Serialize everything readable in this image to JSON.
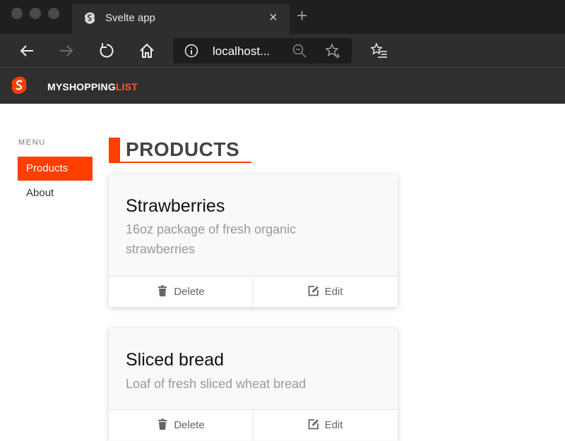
{
  "browser": {
    "tab_title": "Svelte app",
    "tab_close": "×",
    "new_tab": "+",
    "url": "localhost..."
  },
  "app": {
    "brand_part1": "MY",
    "brand_part2": "SHOPPING",
    "brand_part3": "LIST"
  },
  "sidebar": {
    "menu_label": "MENU",
    "items": [
      {
        "label": "Products",
        "active": true
      },
      {
        "label": "About",
        "active": false
      }
    ]
  },
  "main": {
    "page_title": "PRODUCTS",
    "products": [
      {
        "name": "Strawberries",
        "description": "16oz package of fresh organic strawberries",
        "delete_label": "Delete",
        "edit_label": "Edit"
      },
      {
        "name": "Sliced bread",
        "description": "Loaf of fresh sliced wheat bread",
        "delete_label": "Delete",
        "edit_label": "Edit"
      }
    ]
  },
  "colors": {
    "accent": "#ff3e00",
    "header_bg": "#2f2f2f",
    "chrome_bg": "#1f1f1f"
  },
  "icons": [
    "svelte-logo-icon",
    "back-arrow-icon",
    "forward-arrow-icon",
    "refresh-icon",
    "home-icon",
    "info-icon",
    "zoom-out-icon",
    "favorite-star-icon",
    "favorites-list-icon",
    "trash-icon",
    "edit-icon"
  ]
}
